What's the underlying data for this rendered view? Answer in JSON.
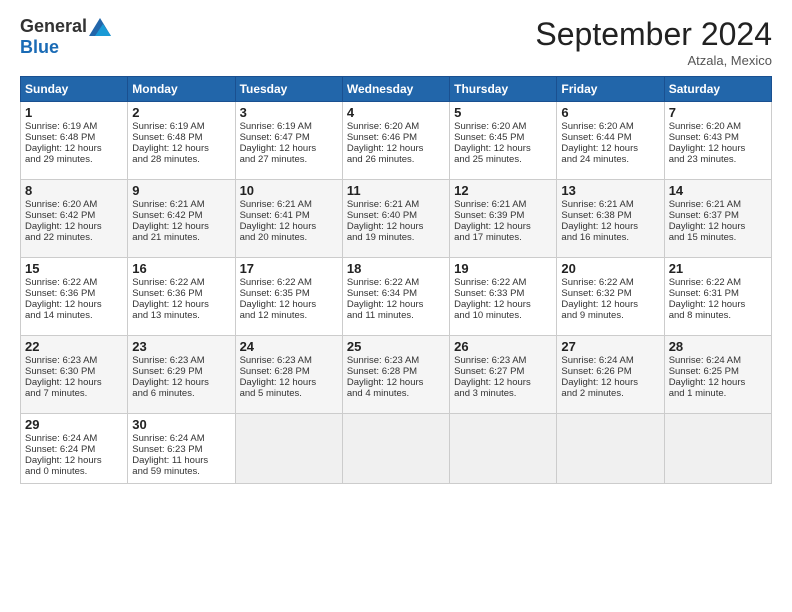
{
  "logo": {
    "general": "General",
    "blue": "Blue"
  },
  "title": "September 2024",
  "location": "Atzala, Mexico",
  "days_header": [
    "Sunday",
    "Monday",
    "Tuesday",
    "Wednesday",
    "Thursday",
    "Friday",
    "Saturday"
  ],
  "weeks": [
    [
      {
        "day": "1",
        "lines": [
          "Sunrise: 6:19 AM",
          "Sunset: 6:48 PM",
          "Daylight: 12 hours",
          "and 29 minutes."
        ]
      },
      {
        "day": "2",
        "lines": [
          "Sunrise: 6:19 AM",
          "Sunset: 6:48 PM",
          "Daylight: 12 hours",
          "and 28 minutes."
        ]
      },
      {
        "day": "3",
        "lines": [
          "Sunrise: 6:19 AM",
          "Sunset: 6:47 PM",
          "Daylight: 12 hours",
          "and 27 minutes."
        ]
      },
      {
        "day": "4",
        "lines": [
          "Sunrise: 6:20 AM",
          "Sunset: 6:46 PM",
          "Daylight: 12 hours",
          "and 26 minutes."
        ]
      },
      {
        "day": "5",
        "lines": [
          "Sunrise: 6:20 AM",
          "Sunset: 6:45 PM",
          "Daylight: 12 hours",
          "and 25 minutes."
        ]
      },
      {
        "day": "6",
        "lines": [
          "Sunrise: 6:20 AM",
          "Sunset: 6:44 PM",
          "Daylight: 12 hours",
          "and 24 minutes."
        ]
      },
      {
        "day": "7",
        "lines": [
          "Sunrise: 6:20 AM",
          "Sunset: 6:43 PM",
          "Daylight: 12 hours",
          "and 23 minutes."
        ]
      }
    ],
    [
      {
        "day": "8",
        "lines": [
          "Sunrise: 6:20 AM",
          "Sunset: 6:42 PM",
          "Daylight: 12 hours",
          "and 22 minutes."
        ]
      },
      {
        "day": "9",
        "lines": [
          "Sunrise: 6:21 AM",
          "Sunset: 6:42 PM",
          "Daylight: 12 hours",
          "and 21 minutes."
        ]
      },
      {
        "day": "10",
        "lines": [
          "Sunrise: 6:21 AM",
          "Sunset: 6:41 PM",
          "Daylight: 12 hours",
          "and 20 minutes."
        ]
      },
      {
        "day": "11",
        "lines": [
          "Sunrise: 6:21 AM",
          "Sunset: 6:40 PM",
          "Daylight: 12 hours",
          "and 19 minutes."
        ]
      },
      {
        "day": "12",
        "lines": [
          "Sunrise: 6:21 AM",
          "Sunset: 6:39 PM",
          "Daylight: 12 hours",
          "and 17 minutes."
        ]
      },
      {
        "day": "13",
        "lines": [
          "Sunrise: 6:21 AM",
          "Sunset: 6:38 PM",
          "Daylight: 12 hours",
          "and 16 minutes."
        ]
      },
      {
        "day": "14",
        "lines": [
          "Sunrise: 6:21 AM",
          "Sunset: 6:37 PM",
          "Daylight: 12 hours",
          "and 15 minutes."
        ]
      }
    ],
    [
      {
        "day": "15",
        "lines": [
          "Sunrise: 6:22 AM",
          "Sunset: 6:36 PM",
          "Daylight: 12 hours",
          "and 14 minutes."
        ]
      },
      {
        "day": "16",
        "lines": [
          "Sunrise: 6:22 AM",
          "Sunset: 6:36 PM",
          "Daylight: 12 hours",
          "and 13 minutes."
        ]
      },
      {
        "day": "17",
        "lines": [
          "Sunrise: 6:22 AM",
          "Sunset: 6:35 PM",
          "Daylight: 12 hours",
          "and 12 minutes."
        ]
      },
      {
        "day": "18",
        "lines": [
          "Sunrise: 6:22 AM",
          "Sunset: 6:34 PM",
          "Daylight: 12 hours",
          "and 11 minutes."
        ]
      },
      {
        "day": "19",
        "lines": [
          "Sunrise: 6:22 AM",
          "Sunset: 6:33 PM",
          "Daylight: 12 hours",
          "and 10 minutes."
        ]
      },
      {
        "day": "20",
        "lines": [
          "Sunrise: 6:22 AM",
          "Sunset: 6:32 PM",
          "Daylight: 12 hours",
          "and 9 minutes."
        ]
      },
      {
        "day": "21",
        "lines": [
          "Sunrise: 6:22 AM",
          "Sunset: 6:31 PM",
          "Daylight: 12 hours",
          "and 8 minutes."
        ]
      }
    ],
    [
      {
        "day": "22",
        "lines": [
          "Sunrise: 6:23 AM",
          "Sunset: 6:30 PM",
          "Daylight: 12 hours",
          "and 7 minutes."
        ]
      },
      {
        "day": "23",
        "lines": [
          "Sunrise: 6:23 AM",
          "Sunset: 6:29 PM",
          "Daylight: 12 hours",
          "and 6 minutes."
        ]
      },
      {
        "day": "24",
        "lines": [
          "Sunrise: 6:23 AM",
          "Sunset: 6:28 PM",
          "Daylight: 12 hours",
          "and 5 minutes."
        ]
      },
      {
        "day": "25",
        "lines": [
          "Sunrise: 6:23 AM",
          "Sunset: 6:28 PM",
          "Daylight: 12 hours",
          "and 4 minutes."
        ]
      },
      {
        "day": "26",
        "lines": [
          "Sunrise: 6:23 AM",
          "Sunset: 6:27 PM",
          "Daylight: 12 hours",
          "and 3 minutes."
        ]
      },
      {
        "day": "27",
        "lines": [
          "Sunrise: 6:24 AM",
          "Sunset: 6:26 PM",
          "Daylight: 12 hours",
          "and 2 minutes."
        ]
      },
      {
        "day": "28",
        "lines": [
          "Sunrise: 6:24 AM",
          "Sunset: 6:25 PM",
          "Daylight: 12 hours",
          "and 1 minute."
        ]
      }
    ],
    [
      {
        "day": "29",
        "lines": [
          "Sunrise: 6:24 AM",
          "Sunset: 6:24 PM",
          "Daylight: 12 hours",
          "and 0 minutes."
        ]
      },
      {
        "day": "30",
        "lines": [
          "Sunrise: 6:24 AM",
          "Sunset: 6:23 PM",
          "Daylight: 11 hours",
          "and 59 minutes."
        ]
      },
      {
        "day": "",
        "lines": []
      },
      {
        "day": "",
        "lines": []
      },
      {
        "day": "",
        "lines": []
      },
      {
        "day": "",
        "lines": []
      },
      {
        "day": "",
        "lines": []
      }
    ]
  ]
}
